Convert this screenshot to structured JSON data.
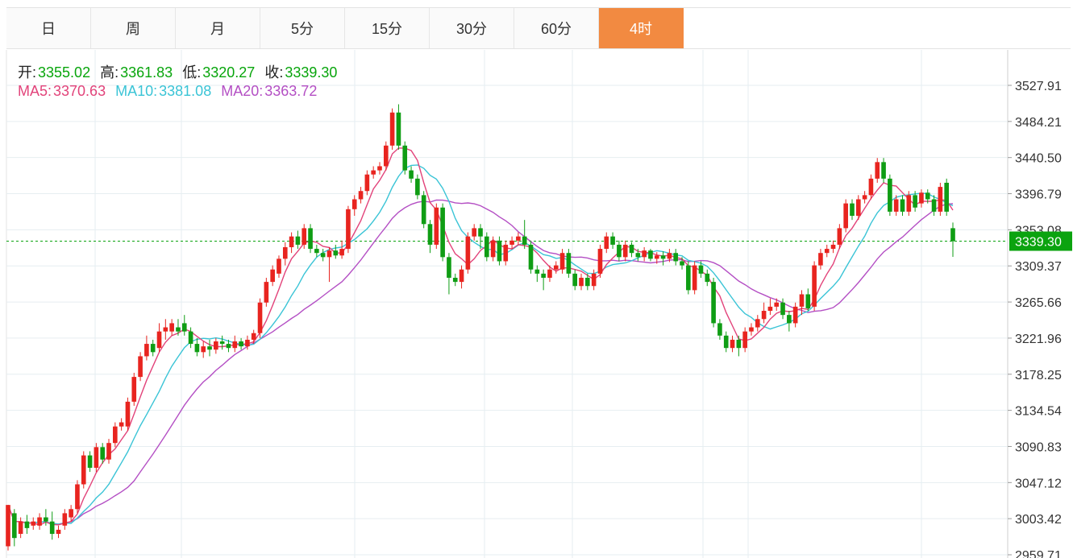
{
  "tabs": [
    "日",
    "周",
    "月",
    "5分",
    "15分",
    "30分",
    "60分",
    "4时"
  ],
  "active_tab": "4时",
  "ohlc": {
    "open_label": "开:",
    "open": "3355.02",
    "high_label": "高:",
    "high": "3361.83",
    "low_label": "低:",
    "low": "3320.27",
    "close_label": "收:",
    "close": "3339.30"
  },
  "ma": {
    "ma5_label": "MA5:",
    "ma5": "3370.63",
    "ma10_label": "MA10:",
    "ma10": "3381.08",
    "ma20_label": "MA20:",
    "ma20": "3363.72"
  },
  "colors": {
    "up": "#e8241f",
    "down": "#0f9d14",
    "ma5": "#e2437a",
    "ma10": "#3ac4d6",
    "ma20": "#b44fc4",
    "accent": "#f28a41",
    "price_tag": "#0ba30f"
  },
  "chart_data": {
    "type": "candlestick",
    "y_ticks": [
      "3527.91",
      "3484.21",
      "3440.50",
      "3396.79",
      "3353.08",
      "3309.37",
      "3265.66",
      "3221.96",
      "3178.25",
      "3134.54",
      "3090.83",
      "3047.12",
      "3003.42",
      "2959.71"
    ],
    "ylim": [
      2959.71,
      3527.91
    ],
    "grid": true,
    "current_price": "3339.30",
    "candles": [
      [
        2970,
        3020,
        2965,
        3010
      ],
      [
        3010,
        2980,
        2970,
        3015
      ],
      [
        2985,
        3000,
        2980,
        3005
      ],
      [
        3000,
        2992,
        2985,
        3008
      ],
      [
        2995,
        3000,
        2990,
        3005
      ],
      [
        2995,
        3005,
        2990,
        3010
      ],
      [
        3005,
        3000,
        2995,
        3015
      ],
      [
        3000,
        2985,
        2978,
        3012
      ],
      [
        2985,
        2990,
        2980,
        2995
      ],
      [
        2995,
        3010,
        2990,
        3015
      ],
      [
        3005,
        3015,
        3000,
        3020
      ],
      [
        3015,
        3045,
        3010,
        3050
      ],
      [
        3045,
        3080,
        3040,
        3085
      ],
      [
        3080,
        3065,
        3060,
        3085
      ],
      [
        3065,
        3090,
        3060,
        3095
      ],
      [
        3090,
        3075,
        3070,
        3095
      ],
      [
        3075,
        3095,
        3070,
        3100
      ],
      [
        3095,
        3115,
        3090,
        3120
      ],
      [
        3115,
        3120,
        3110,
        3125
      ],
      [
        3115,
        3145,
        3110,
        3150
      ],
      [
        3145,
        3175,
        3140,
        3180
      ],
      [
        3175,
        3200,
        3170,
        3205
      ],
      [
        3200,
        3215,
        3195,
        3225
      ],
      [
        3215,
        3205,
        3200,
        3220
      ],
      [
        3210,
        3230,
        3205,
        3240
      ],
      [
        3230,
        3235,
        3220,
        3245
      ],
      [
        3230,
        3240,
        3225,
        3245
      ],
      [
        3235,
        3230,
        3225,
        3245
      ],
      [
        3240,
        3230,
        3225,
        3250
      ],
      [
        3230,
        3215,
        3210,
        3235
      ],
      [
        3215,
        3205,
        3200,
        3222
      ],
      [
        3205,
        3212,
        3198,
        3218
      ],
      [
        3212,
        3208,
        3200,
        3220
      ],
      [
        3208,
        3218,
        3203,
        3222
      ],
      [
        3218,
        3215,
        3208,
        3225
      ],
      [
        3215,
        3210,
        3205,
        3220
      ],
      [
        3210,
        3218,
        3205,
        3225
      ],
      [
        3218,
        3212,
        3208,
        3222
      ],
      [
        3212,
        3220,
        3208,
        3225
      ],
      [
        3220,
        3228,
        3215,
        3232
      ],
      [
        3228,
        3265,
        3222,
        3270
      ],
      [
        3265,
        3290,
        3260,
        3295
      ],
      [
        3290,
        3305,
        3285,
        3310
      ],
      [
        3300,
        3318,
        3295,
        3322
      ],
      [
        3318,
        3332,
        3310,
        3338
      ],
      [
        3332,
        3345,
        3325,
        3350
      ],
      [
        3345,
        3335,
        3330,
        3352
      ],
      [
        3335,
        3355,
        3330,
        3360
      ],
      [
        3355,
        3330,
        3325,
        3360
      ],
      [
        3330,
        3325,
        3320,
        3335
      ],
      [
        3325,
        3320,
        3315,
        3330
      ],
      [
        3320,
        3328,
        3290,
        3332
      ],
      [
        3328,
        3322,
        3318,
        3335
      ],
      [
        3322,
        3330,
        3318,
        3340
      ],
      [
        3330,
        3378,
        3325,
        3382
      ],
      [
        3378,
        3390,
        3370,
        3395
      ],
      [
        3390,
        3400,
        3385,
        3405
      ],
      [
        3400,
        3420,
        3395,
        3425
      ],
      [
        3420,
        3425,
        3415,
        3430
      ],
      [
        3425,
        3430,
        3420,
        3435
      ],
      [
        3430,
        3455,
        3425,
        3460
      ],
      [
        3455,
        3495,
        3450,
        3500
      ],
      [
        3495,
        3455,
        3450,
        3505
      ],
      [
        3455,
        3425,
        3420,
        3460
      ],
      [
        3425,
        3415,
        3410,
        3430
      ],
      [
        3415,
        3395,
        3390,
        3420
      ],
      [
        3395,
        3360,
        3355,
        3400
      ],
      [
        3360,
        3335,
        3325,
        3365
      ],
      [
        3335,
        3380,
        3330,
        3385
      ],
      [
        3380,
        3320,
        3315,
        3385
      ],
      [
        3320,
        3295,
        3275,
        3325
      ],
      [
        3295,
        3290,
        3285,
        3300
      ],
      [
        3290,
        3305,
        3282,
        3310
      ],
      [
        3305,
        3345,
        3300,
        3350
      ],
      [
        3345,
        3355,
        3340,
        3360
      ],
      [
        3355,
        3345,
        3330,
        3360
      ],
      [
        3345,
        3320,
        3315,
        3350
      ],
      [
        3320,
        3340,
        3315,
        3345
      ],
      [
        3340,
        3315,
        3310,
        3345
      ],
      [
        3315,
        3335,
        3310,
        3340
      ],
      [
        3335,
        3340,
        3330,
        3345
      ],
      [
        3340,
        3345,
        3335,
        3350
      ],
      [
        3345,
        3335,
        3330,
        3365
      ],
      [
        3335,
        3305,
        3300,
        3340
      ],
      [
        3305,
        3300,
        3290,
        3310
      ],
      [
        3300,
        3295,
        3280,
        3305
      ],
      [
        3295,
        3305,
        3290,
        3310
      ],
      [
        3305,
        3310,
        3300,
        3315
      ],
      [
        3305,
        3325,
        3300,
        3330
      ],
      [
        3325,
        3300,
        3295,
        3330
      ],
      [
        3300,
        3285,
        3280,
        3305
      ],
      [
        3285,
        3295,
        3280,
        3300
      ],
      [
        3295,
        3285,
        3280,
        3300
      ],
      [
        3285,
        3300,
        3280,
        3305
      ],
      [
        3300,
        3330,
        3295,
        3335
      ],
      [
        3330,
        3345,
        3325,
        3350
      ],
      [
        3345,
        3335,
        3330,
        3350
      ],
      [
        3335,
        3320,
        3315,
        3340
      ],
      [
        3320,
        3335,
        3315,
        3340
      ],
      [
        3335,
        3325,
        3320,
        3338
      ],
      [
        3325,
        3320,
        3315,
        3330
      ],
      [
        3320,
        3328,
        3315,
        3332
      ],
      [
        3328,
        3318,
        3315,
        3330
      ],
      [
        3318,
        3322,
        3312,
        3326
      ],
      [
        3322,
        3318,
        3310,
        3327
      ],
      [
        3318,
        3325,
        3314,
        3330
      ],
      [
        3325,
        3315,
        3310,
        3330
      ],
      [
        3315,
        3310,
        3305,
        3320
      ],
      [
        3310,
        3280,
        3275,
        3315
      ],
      [
        3280,
        3310,
        3275,
        3315
      ],
      [
        3310,
        3300,
        3295,
        3315
      ],
      [
        3300,
        3290,
        3285,
        3305
      ],
      [
        3290,
        3240,
        3235,
        3295
      ],
      [
        3240,
        3225,
        3220,
        3245
      ],
      [
        3225,
        3210,
        3205,
        3230
      ],
      [
        3210,
        3220,
        3205,
        3225
      ],
      [
        3220,
        3210,
        3200,
        3225
      ],
      [
        3210,
        3230,
        3205,
        3235
      ],
      [
        3230,
        3235,
        3225,
        3240
      ],
      [
        3235,
        3245,
        3230,
        3250
      ],
      [
        3245,
        3255,
        3240,
        3265
      ],
      [
        3255,
        3260,
        3250,
        3270
      ],
      [
        3260,
        3265,
        3255,
        3270
      ],
      [
        3265,
        3250,
        3245,
        3270
      ],
      [
        3250,
        3240,
        3230,
        3255
      ],
      [
        3240,
        3260,
        3235,
        3265
      ],
      [
        3260,
        3275,
        3250,
        3280
      ],
      [
        3275,
        3258,
        3255,
        3282
      ],
      [
        3260,
        3310,
        3255,
        3315
      ],
      [
        3310,
        3325,
        3305,
        3330
      ],
      [
        3325,
        3330,
        3320,
        3335
      ],
      [
        3330,
        3335,
        3325,
        3340
      ],
      [
        3335,
        3355,
        3330,
        3360
      ],
      [
        3355,
        3385,
        3350,
        3390
      ],
      [
        3385,
        3370,
        3365,
        3390
      ],
      [
        3370,
        3390,
        3365,
        3395
      ],
      [
        3390,
        3395,
        3385,
        3400
      ],
      [
        3395,
        3415,
        3390,
        3420
      ],
      [
        3415,
        3435,
        3410,
        3440
      ],
      [
        3435,
        3415,
        3410,
        3440
      ],
      [
        3415,
        3375,
        3370,
        3420
      ],
      [
        3375,
        3390,
        3370,
        3395
      ],
      [
        3390,
        3375,
        3370,
        3395
      ],
      [
        3375,
        3395,
        3370,
        3400
      ],
      [
        3395,
        3380,
        3375,
        3400
      ],
      [
        3385,
        3398,
        3380,
        3402
      ],
      [
        3398,
        3390,
        3385,
        3402
      ],
      [
        3390,
        3375,
        3370,
        3395
      ],
      [
        3375,
        3405,
        3370,
        3410
      ],
      [
        3410,
        3375,
        3370,
        3415
      ],
      [
        3355.02,
        3339.3,
        3320.27,
        3361.83
      ]
    ]
  }
}
